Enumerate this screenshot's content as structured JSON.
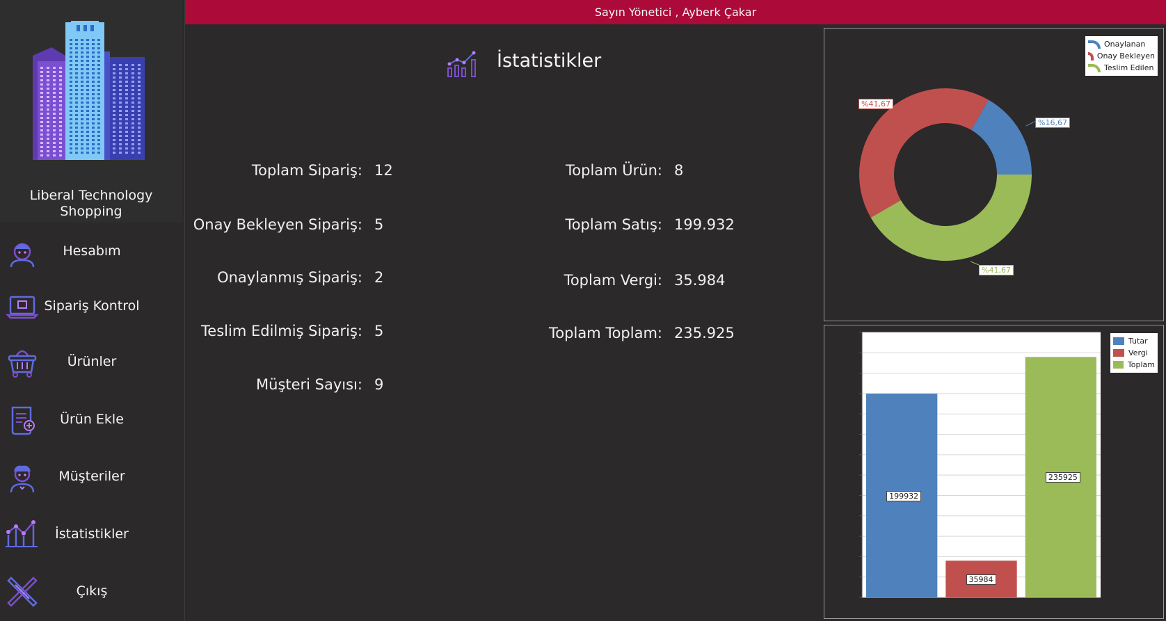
{
  "header": {
    "greeting": "Sayın Yönetici , Ayberk Çakar"
  },
  "brand": {
    "name": "Liberal Technology Shopping",
    "logo_icon": "skyscraper-buildings-icon"
  },
  "sidebar": {
    "items": [
      {
        "label": "Hesabım",
        "icon": "account-user-icon"
      },
      {
        "label": "Sipariş Kontrol",
        "icon": "laptop-order-icon"
      },
      {
        "label": "Ürünler",
        "icon": "shopping-basket-icon"
      },
      {
        "label": "Ürün Ekle",
        "icon": "scroll-add-icon"
      },
      {
        "label": "Müşteriler",
        "icon": "customer-icon"
      },
      {
        "label": "İstatistikler",
        "icon": "statistics-graph-icon"
      },
      {
        "label": "Çıkış",
        "icon": "close-x-icon"
      }
    ]
  },
  "main": {
    "title": "İstatistikler",
    "title_icon": "statistics-chart-icon",
    "stats_left": [
      {
        "label": "Toplam Sipariş:",
        "value": "12"
      },
      {
        "label": "Onay Bekleyen Sipariş:",
        "value": "5"
      },
      {
        "label": "Onaylanmış Sipariş:",
        "value": "2"
      },
      {
        "label": "Teslim Edilmiş Sipariş:",
        "value": "5"
      },
      {
        "label": "Müşteri Sayısı:",
        "value": "9"
      }
    ],
    "stats_right": [
      {
        "label": "Toplam Ürün:",
        "value": "8"
      },
      {
        "label": "Toplam Satış:",
        "value": "199.932"
      },
      {
        "label": "Toplam Vergi:",
        "value": "35.984"
      },
      {
        "label": "Toplam Toplam:",
        "value": "235.925"
      }
    ]
  },
  "colors": {
    "blue": "#4f81bd",
    "red": "#c0504d",
    "green": "#9bbb59",
    "header": "#ac0a38"
  },
  "chart_data": [
    {
      "type": "pie",
      "variant": "doughnut",
      "series": [
        {
          "name": "Onaylanan",
          "value": 16.67,
          "label": "%16,67",
          "color": "#4f81bd"
        },
        {
          "name": "Onay Bekleyen",
          "value": 41.67,
          "label": "%41,67",
          "color": "#c0504d"
        },
        {
          "name": "Teslim Edilen",
          "value": 41.67,
          "label": "%41,67",
          "color": "#9bbb59"
        }
      ],
      "legend": "top-right"
    },
    {
      "type": "bar",
      "categories": [
        "Tutar",
        "Vergi",
        "Toplam"
      ],
      "values": [
        199932,
        35984,
        235925
      ],
      "data_labels": [
        "199932",
        "35984",
        "235925"
      ],
      "colors": [
        "#4f81bd",
        "#c0504d",
        "#9bbb59"
      ],
      "ylim": [
        0,
        260000
      ],
      "grid": true,
      "legend": "top-right"
    }
  ]
}
